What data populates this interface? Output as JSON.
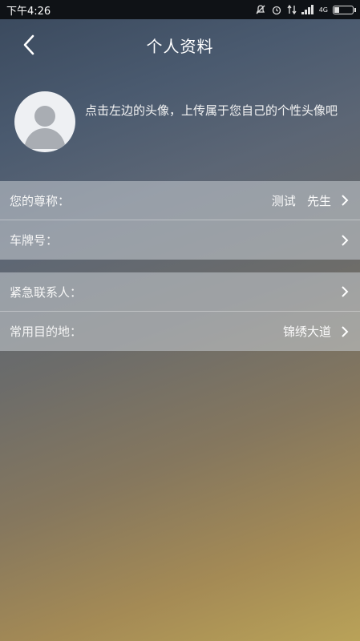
{
  "status_bar": {
    "time": "下午4:26",
    "icons": [
      "mute-icon",
      "alarm-icon",
      "data-arrows-icon",
      "signal-icon",
      "4g-icon",
      "battery-icon"
    ],
    "network_label": "4G"
  },
  "header": {
    "title": "个人资料",
    "back_icon": "chevron-left-icon"
  },
  "profile": {
    "hint": "点击左边的头像，上传属于您自己的个性头像吧"
  },
  "section1": [
    {
      "label": "您的尊称：",
      "value": "测试   先生"
    },
    {
      "label": "车牌号：",
      "value": ""
    }
  ],
  "section2": [
    {
      "label": "紧急联系人：",
      "value": ""
    },
    {
      "label": "常用目的地：",
      "value": "锦绣大道"
    }
  ],
  "colors": {
    "status_bar_bg": "#0f1216",
    "row_bg": "rgba(200,205,212,0.55)",
    "text": "#ffffff"
  }
}
